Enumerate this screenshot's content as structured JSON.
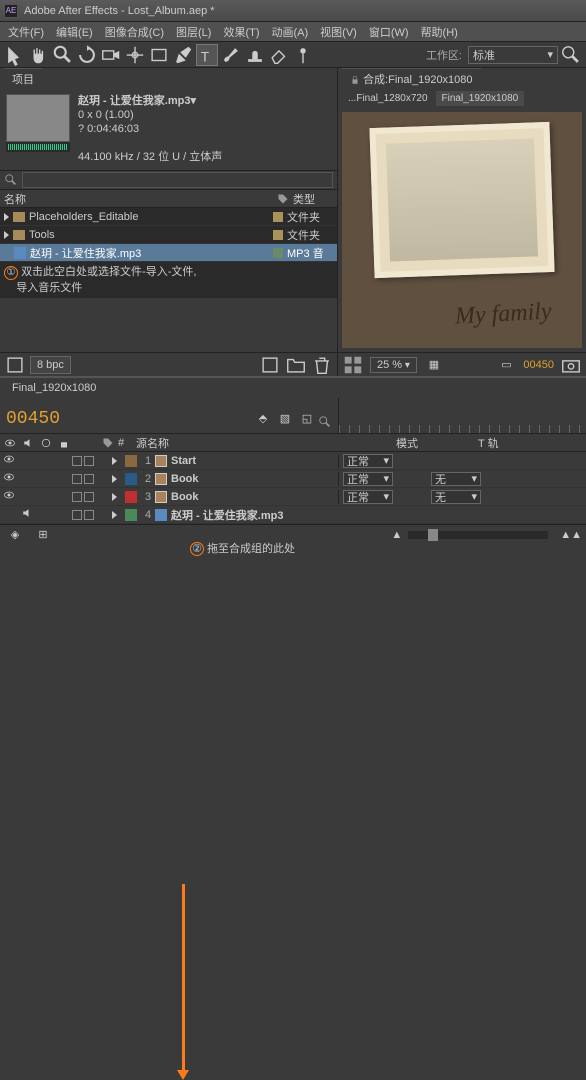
{
  "title_bar": {
    "app_icon_text": "AE",
    "title": "Adobe After Effects - Lost_Album.aep *"
  },
  "menu_bar": {
    "items": [
      "文件(F)",
      "编辑(E)",
      "图像合成(C)",
      "图层(L)",
      "效果(T)",
      "动画(A)",
      "视图(V)",
      "窗口(W)",
      "帮助(H)"
    ]
  },
  "toolbar": {
    "workspace_label": "工作区:",
    "workspace_value": "标准"
  },
  "project_panel": {
    "tab": "项目",
    "asset_title": "赵玥 - 让爱住我家.mp3▾",
    "asset_size": "0 x 0 (1.00)",
    "asset_duration": "? 0:04:46:03",
    "asset_audio": "44.100 kHz / 32 位 U / 立体声",
    "col_name": "名称",
    "col_type": "类型",
    "rows": [
      {
        "name": "Placeholders_Editable",
        "type": "文件夹"
      },
      {
        "name": "Tools",
        "type": "文件夹"
      },
      {
        "name": "赵玥 - 让爱住我家.mp3",
        "type": "MP3 音"
      }
    ],
    "bpc": "8 bpc"
  },
  "annotation1": {
    "num": "①",
    "text_a": "双击此空白处或选择文件-导入-文件,",
    "text_b": "导入音乐文件"
  },
  "annotation2": {
    "num": "②",
    "text": "拖至合成组的此处"
  },
  "comp_panel": {
    "tab_prefix": "合成:",
    "tab_value": "Final_1920x1080",
    "sub_tab_a": "...Final_1280x720",
    "sub_tab_b": "Final_1920x1080",
    "signature": "My family",
    "zoom": "25 %",
    "frame": "00450"
  },
  "timeline": {
    "tab": "Final_1920x1080",
    "timecode": "00450",
    "col_num": "#",
    "col_source": "源名称",
    "col_mode": "模式",
    "col_trk": "T 轨",
    "layers": [
      {
        "num": "1",
        "name": "Start",
        "color": "#8b6840",
        "mode": "正常"
      },
      {
        "num": "2",
        "name": "Book",
        "color": "#2a5a8a",
        "mode": "正常",
        "trk": "无"
      },
      {
        "num": "3",
        "name": "Book",
        "color": "#c03030",
        "mode": "正常",
        "trk": "无"
      },
      {
        "num": "4",
        "name": "赵玥 - 让爱住我家.mp3",
        "color": "#4a8a5a",
        "audio": true
      }
    ]
  }
}
